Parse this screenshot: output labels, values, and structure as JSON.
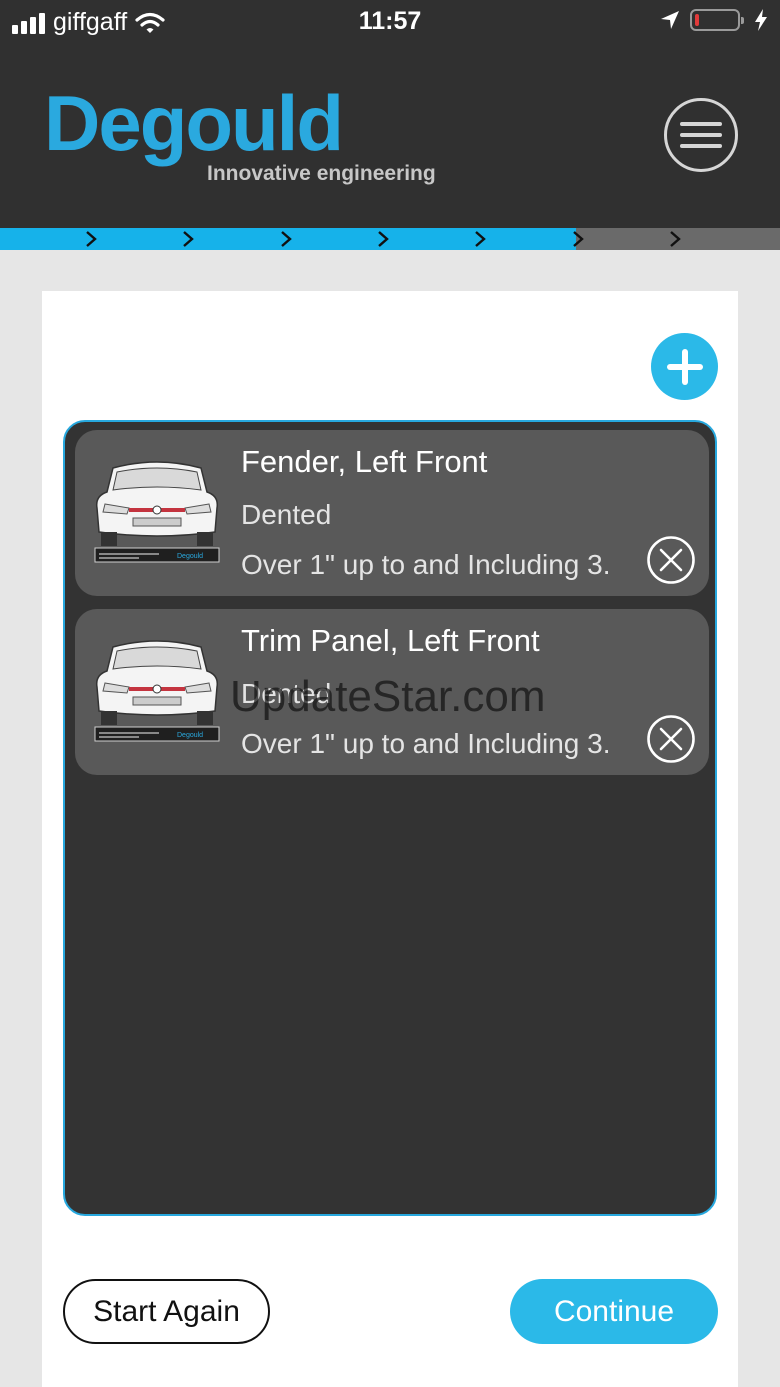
{
  "status_bar": {
    "carrier": "giffgaff",
    "time": "11:57",
    "icons": [
      "signal-bars-icon",
      "wifi-icon",
      "location-arrow-icon",
      "battery-low-icon",
      "charging-bolt-icon"
    ]
  },
  "header": {
    "logo_text": "Degould",
    "tagline": "Innovative engineering",
    "menu_icon": "hamburger-menu-icon"
  },
  "progress": {
    "steps_total": 7,
    "steps_completed": 6,
    "colors": {
      "done": "#16b2ea",
      "remaining": "#6a6a6a"
    }
  },
  "damage_list": {
    "add_icon": "plus-icon",
    "items": [
      {
        "title": "Fender, Left Front",
        "status": "Dented",
        "description": "Over 1\" up to and Including 3.",
        "thumbnail_icon": "car-front-icon",
        "thumbnail_brand": "Degould",
        "remove_icon": "close-circle-icon"
      },
      {
        "title": "Trim Panel, Left Front",
        "status": "Dented",
        "description": "Over 1\" up to and Including 3.",
        "thumbnail_icon": "car-front-icon",
        "thumbnail_brand": "Degould",
        "remove_icon": "close-circle-icon"
      }
    ]
  },
  "watermark": "UpdateStar.com",
  "actions": {
    "start_again": "Start Again",
    "continue": "Continue"
  },
  "colors": {
    "accent": "#2bb9e8",
    "header_bg": "#303030",
    "list_bg": "#333333",
    "item_bg": "#595959"
  }
}
